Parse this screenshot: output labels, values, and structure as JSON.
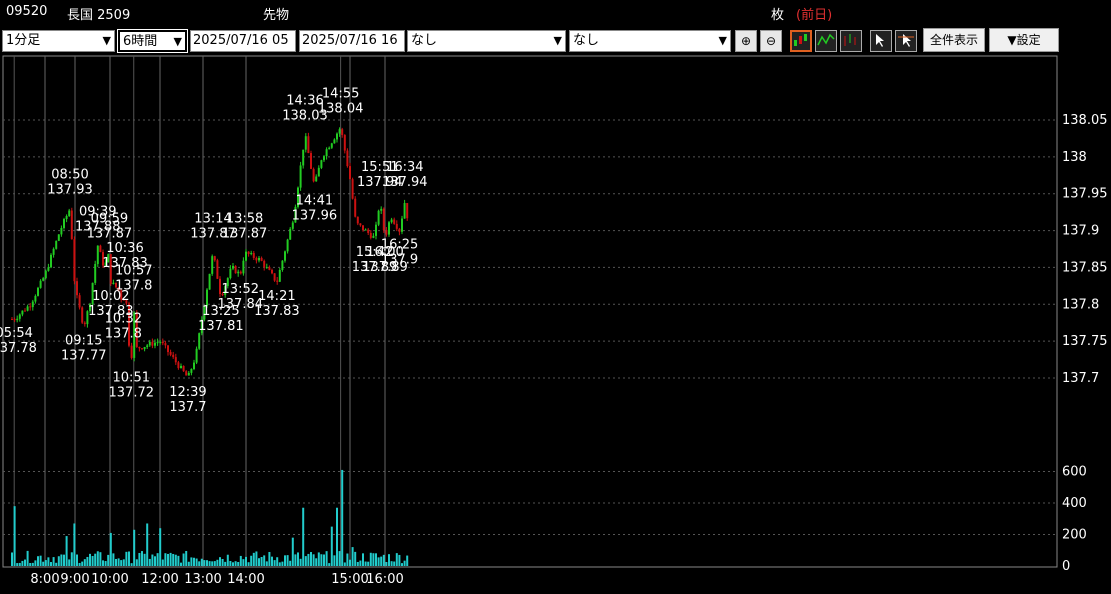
{
  "header": {
    "code": "09520",
    "name": "長国 2509",
    "category": "先物",
    "unit": "枚",
    "prev_day": "(前日)"
  },
  "toolbar": {
    "interval": "1分足",
    "span": "6時間",
    "from": "2025/07/16 05",
    "to": "2025/07/16 16",
    "indicator1": "なし",
    "indicator2": "なし",
    "show_all": "全件表示",
    "settings": "▼設定"
  },
  "colors": {
    "up": "#22cc22",
    "down": "#cc1111",
    "volume": "#22cccc",
    "grid": "#555555",
    "accent": "#e06020"
  },
  "chart_data": {
    "type": "candlestick",
    "price_ticks": [
      "138.05",
      "138",
      "137.95",
      "137.9",
      "137.85",
      "137.8",
      "137.75",
      "137.7"
    ],
    "volume_ticks": [
      "600",
      "400",
      "200",
      "0"
    ],
    "time_ticks": [
      "8:00",
      "9:00",
      "10:00",
      "12:00",
      "13:00",
      "14:00",
      "15:00",
      "16:00"
    ],
    "price_range": [
      137.685,
      138.08
    ],
    "volume_range": [
      0,
      700
    ],
    "price_path": [
      [
        "05:45",
        137.78
      ],
      [
        "05:54",
        137.78
      ],
      [
        "07:00",
        137.8
      ],
      [
        "08:00",
        137.84
      ],
      [
        "08:30",
        137.9
      ],
      [
        "08:50",
        137.93
      ],
      [
        "09:00",
        137.82
      ],
      [
        "09:15",
        137.77
      ],
      [
        "09:25",
        137.8
      ],
      [
        "09:39",
        137.88
      ],
      [
        "09:50",
        137.85
      ],
      [
        "09:59",
        137.87
      ],
      [
        "10:02",
        137.83
      ],
      [
        "10:20",
        137.82
      ],
      [
        "10:32",
        137.8
      ],
      [
        "10:36",
        137.83
      ],
      [
        "10:45",
        137.75
      ],
      [
        "10:51",
        137.72
      ],
      [
        "10:57",
        137.8
      ],
      [
        "11:02",
        137.74
      ],
      [
        "12:00",
        137.75
      ],
      [
        "12:39",
        137.7
      ],
      [
        "12:50",
        137.73
      ],
      [
        "13:00",
        137.79
      ],
      [
        "13:14",
        137.87
      ],
      [
        "13:25",
        137.81
      ],
      [
        "13:40",
        137.85
      ],
      [
        "13:52",
        137.84
      ],
      [
        "13:58",
        137.87
      ],
      [
        "14:10",
        137.86
      ],
      [
        "14:21",
        137.83
      ],
      [
        "14:30",
        137.92
      ],
      [
        "14:36",
        138.03
      ],
      [
        "14:41",
        137.96
      ],
      [
        "14:45",
        138.0
      ],
      [
        "14:55",
        138.04
      ],
      [
        "15:00",
        137.97
      ],
      [
        "15:10",
        137.91
      ],
      [
        "15:42",
        137.89
      ],
      [
        "15:51",
        137.94
      ],
      [
        "16:00",
        137.89
      ],
      [
        "16:10",
        137.92
      ],
      [
        "16:25",
        137.9
      ],
      [
        "16:34",
        137.94
      ],
      [
        "16:40",
        137.91
      ]
    ],
    "annotations": [
      {
        "time": "05:54",
        "price": 137.78,
        "text": "05:54\n137.78",
        "pos": "below"
      },
      {
        "time": "08:50",
        "price": 137.93,
        "text": "08:50\n137.93",
        "pos": "above"
      },
      {
        "time": "09:15",
        "price": 137.77,
        "text": "09:15\n137.77",
        "pos": "below"
      },
      {
        "time": "09:39",
        "price": 137.88,
        "text": "09:39\n137.88",
        "pos": "above"
      },
      {
        "time": "09:59",
        "price": 137.87,
        "text": "09:59\n137.87",
        "pos": "above"
      },
      {
        "time": "10:02",
        "price": 137.83,
        "text": "10:02\n137.83",
        "pos": "below"
      },
      {
        "time": "10:32",
        "price": 137.8,
        "text": "10:32\n137.8",
        "pos": "below"
      },
      {
        "time": "10:36",
        "price": 137.83,
        "text": "10:36\n137.83",
        "pos": "above"
      },
      {
        "time": "10:51",
        "price": 137.72,
        "text": "10:51\n137.72",
        "pos": "below"
      },
      {
        "time": "10:57",
        "price": 137.8,
        "text": "10:57\n137.8",
        "pos": "above"
      },
      {
        "time": "12:39",
        "price": 137.7,
        "text": "12:39\n137.7",
        "pos": "below"
      },
      {
        "time": "13:14",
        "price": 137.87,
        "text": "13:14\n137.87",
        "pos": "above"
      },
      {
        "time": "13:25",
        "price": 137.81,
        "text": "13:25\n137.81",
        "pos": "below"
      },
      {
        "time": "13:52",
        "price": 137.84,
        "text": "13:52\n137.84",
        "pos": "below"
      },
      {
        "time": "13:58",
        "price": 137.87,
        "text": "13:58\n137.87",
        "pos": "above"
      },
      {
        "time": "14:21",
        "price": 137.83,
        "text": "14:21\n137.83",
        "pos": "below"
      },
      {
        "time": "14:36",
        "price": 138.03,
        "text": "14:36\n138.03",
        "pos": "above"
      },
      {
        "time": "14:41",
        "price": 137.96,
        "text": "14:41\n137.96",
        "pos": "below"
      },
      {
        "time": "14:55",
        "price": 138.04,
        "text": "14:55\n138.04",
        "pos": "above"
      },
      {
        "time": "15:42",
        "price": 137.89,
        "text": "15:42\n137.89",
        "pos": "below"
      },
      {
        "time": "15:51",
        "price": 137.94,
        "text": "15:51\n137.94",
        "pos": "above"
      },
      {
        "time": "16:00",
        "price": 137.89,
        "text": "16:00\n137.89",
        "pos": "below"
      },
      {
        "time": "16:25",
        "price": 137.9,
        "text": "16:25\n137.9",
        "pos": "below"
      },
      {
        "time": "16:34",
        "price": 137.94,
        "text": "16:34\n137.94",
        "pos": "above"
      }
    ],
    "volume_spikes": [
      [
        "05:54",
        380
      ],
      [
        "08:45",
        190
      ],
      [
        "09:00",
        270
      ],
      [
        "10:00",
        210
      ],
      [
        "11:00",
        230
      ],
      [
        "11:30",
        270
      ],
      [
        "12:00",
        240
      ],
      [
        "14:30",
        180
      ],
      [
        "14:35",
        370
      ],
      [
        "14:50",
        250
      ],
      [
        "14:53",
        370
      ],
      [
        "14:56",
        610
      ],
      [
        "15:05",
        120
      ]
    ],
    "volume_base": 60
  }
}
